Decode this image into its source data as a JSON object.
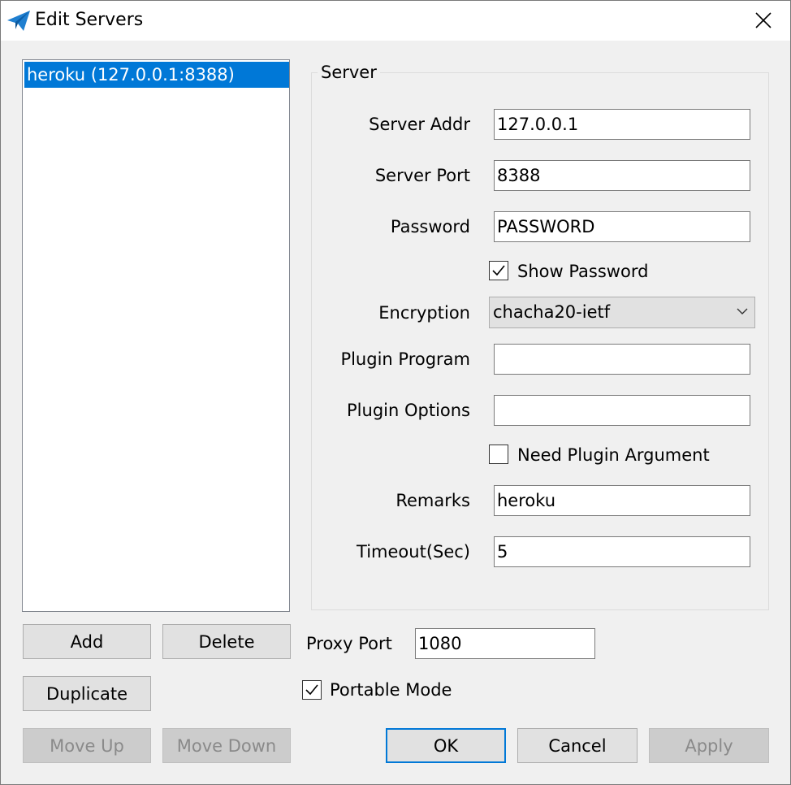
{
  "window": {
    "title": "Edit Servers",
    "icon": "paper-plane-icon"
  },
  "server_list": {
    "items": [
      "heroku (127.0.0.1:8388)"
    ],
    "selected_index": 0
  },
  "server_group": {
    "title": "Server",
    "fields": {
      "server_addr": {
        "label": "Server Addr",
        "value": "127.0.0.1"
      },
      "server_port": {
        "label": "Server Port",
        "value": "8388"
      },
      "password": {
        "label": "Password",
        "value": "PASSWORD"
      },
      "show_password": {
        "label": "Show Password",
        "checked": true
      },
      "encryption": {
        "label": "Encryption",
        "value": "chacha20-ietf"
      },
      "plugin_program": {
        "label": "Plugin Program",
        "value": ""
      },
      "plugin_options": {
        "label": "Plugin Options",
        "value": ""
      },
      "need_plugin_argument": {
        "label": "Need Plugin Argument",
        "checked": false
      },
      "remarks": {
        "label": "Remarks",
        "value": "heroku"
      },
      "timeout": {
        "label": "Timeout(Sec)",
        "value": "5"
      }
    }
  },
  "proxy": {
    "port_label": "Proxy Port",
    "port_value": "1080",
    "portable_mode_label": "Portable Mode",
    "portable_mode_checked": true
  },
  "buttons": {
    "add": "Add",
    "delete": "Delete",
    "duplicate": "Duplicate",
    "move_up": "Move Up",
    "move_down": "Move Down",
    "ok": "OK",
    "cancel": "Cancel",
    "apply": "Apply"
  },
  "colors": {
    "selection": "#0078d7",
    "window_bg": "#f0f0f0",
    "button_bg": "#e1e1e1",
    "disabled_text": "#8a8a8a"
  }
}
